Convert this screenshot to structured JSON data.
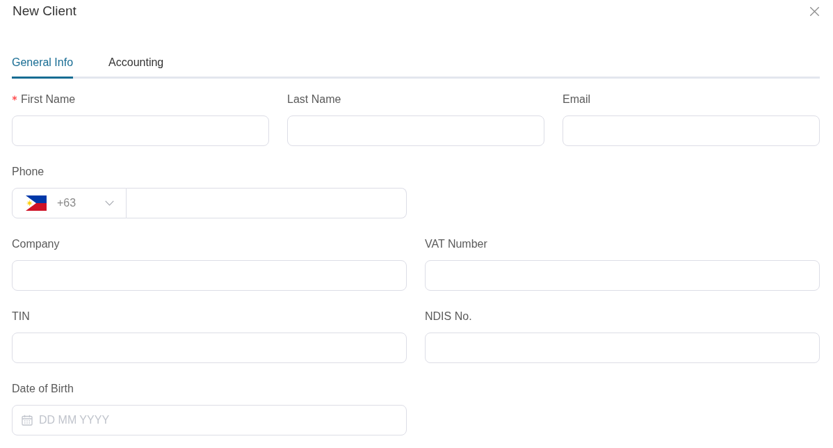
{
  "dialog": {
    "title": "New Client"
  },
  "tabs": [
    {
      "label": "General Info",
      "selected": true
    },
    {
      "label": "Accounting",
      "selected": false
    }
  ],
  "form": {
    "rows": [
      {
        "fields": [
          {
            "kind": "text",
            "label": "First Name",
            "required": true
          },
          {
            "kind": "text",
            "label": "Last Name",
            "required": false
          },
          {
            "kind": "text",
            "label": "Email",
            "required": false
          }
        ]
      },
      {
        "fields": [
          {
            "kind": "phone",
            "label": "Phone",
            "required": false,
            "country_code": "+63"
          }
        ]
      },
      {
        "fields": [
          {
            "kind": "text",
            "label": "Company",
            "required": false
          },
          {
            "kind": "text",
            "label": "VAT Number",
            "required": false
          }
        ]
      },
      {
        "fields": [
          {
            "kind": "text",
            "label": "TIN",
            "required": false
          },
          {
            "kind": "text",
            "label": "NDIS No.",
            "required": false
          }
        ]
      },
      {
        "fields": [
          {
            "kind": "date",
            "label": "Date of Birth",
            "required": false,
            "placeholder": "DD MM YYYY"
          }
        ]
      }
    ]
  }
}
